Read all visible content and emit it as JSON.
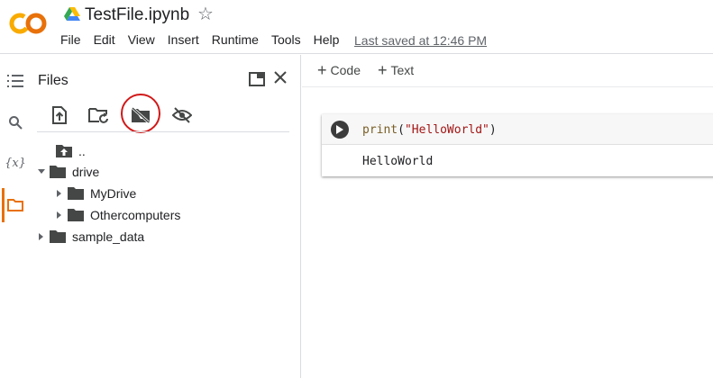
{
  "header": {
    "logo_text": "CO",
    "title": "TestFile.ipynb",
    "menu": [
      "File",
      "Edit",
      "View",
      "Insert",
      "Runtime",
      "Tools",
      "Help"
    ],
    "last_saved": "Last saved at 12:46 PM"
  },
  "rail": {
    "icons": [
      "table-of-contents-icon",
      "search-icon",
      "variables-icon",
      "folder-icon"
    ],
    "variables_label": "{x}"
  },
  "files": {
    "title": "Files",
    "toolbar_icons": [
      "upload-icon",
      "refresh-folder-icon",
      "unmount-drive-icon",
      "hide-icon"
    ],
    "tree": [
      {
        "label": "..",
        "indent": 0,
        "caret": "none",
        "icon": "folder-up-icon"
      },
      {
        "label": "drive",
        "indent": 0,
        "caret": "down",
        "icon": "folder-icon"
      },
      {
        "label": "MyDrive",
        "indent": 1,
        "caret": "right",
        "icon": "folder-icon"
      },
      {
        "label": "Othercomputers",
        "indent": 1,
        "caret": "right",
        "icon": "folder-icon"
      },
      {
        "label": "sample_data",
        "indent": 0,
        "caret": "right",
        "icon": "folder-icon"
      }
    ]
  },
  "main": {
    "add_code": "Code",
    "add_text": "Text",
    "cell": {
      "code_fn": "print",
      "code_open": "(",
      "code_string": "\"HelloWorld\"",
      "code_close": ")",
      "output": "HelloWorld"
    }
  },
  "colors": {
    "accent": "#e8710a",
    "highlight": "#d11919",
    "run_button": "#3c3c3c"
  }
}
